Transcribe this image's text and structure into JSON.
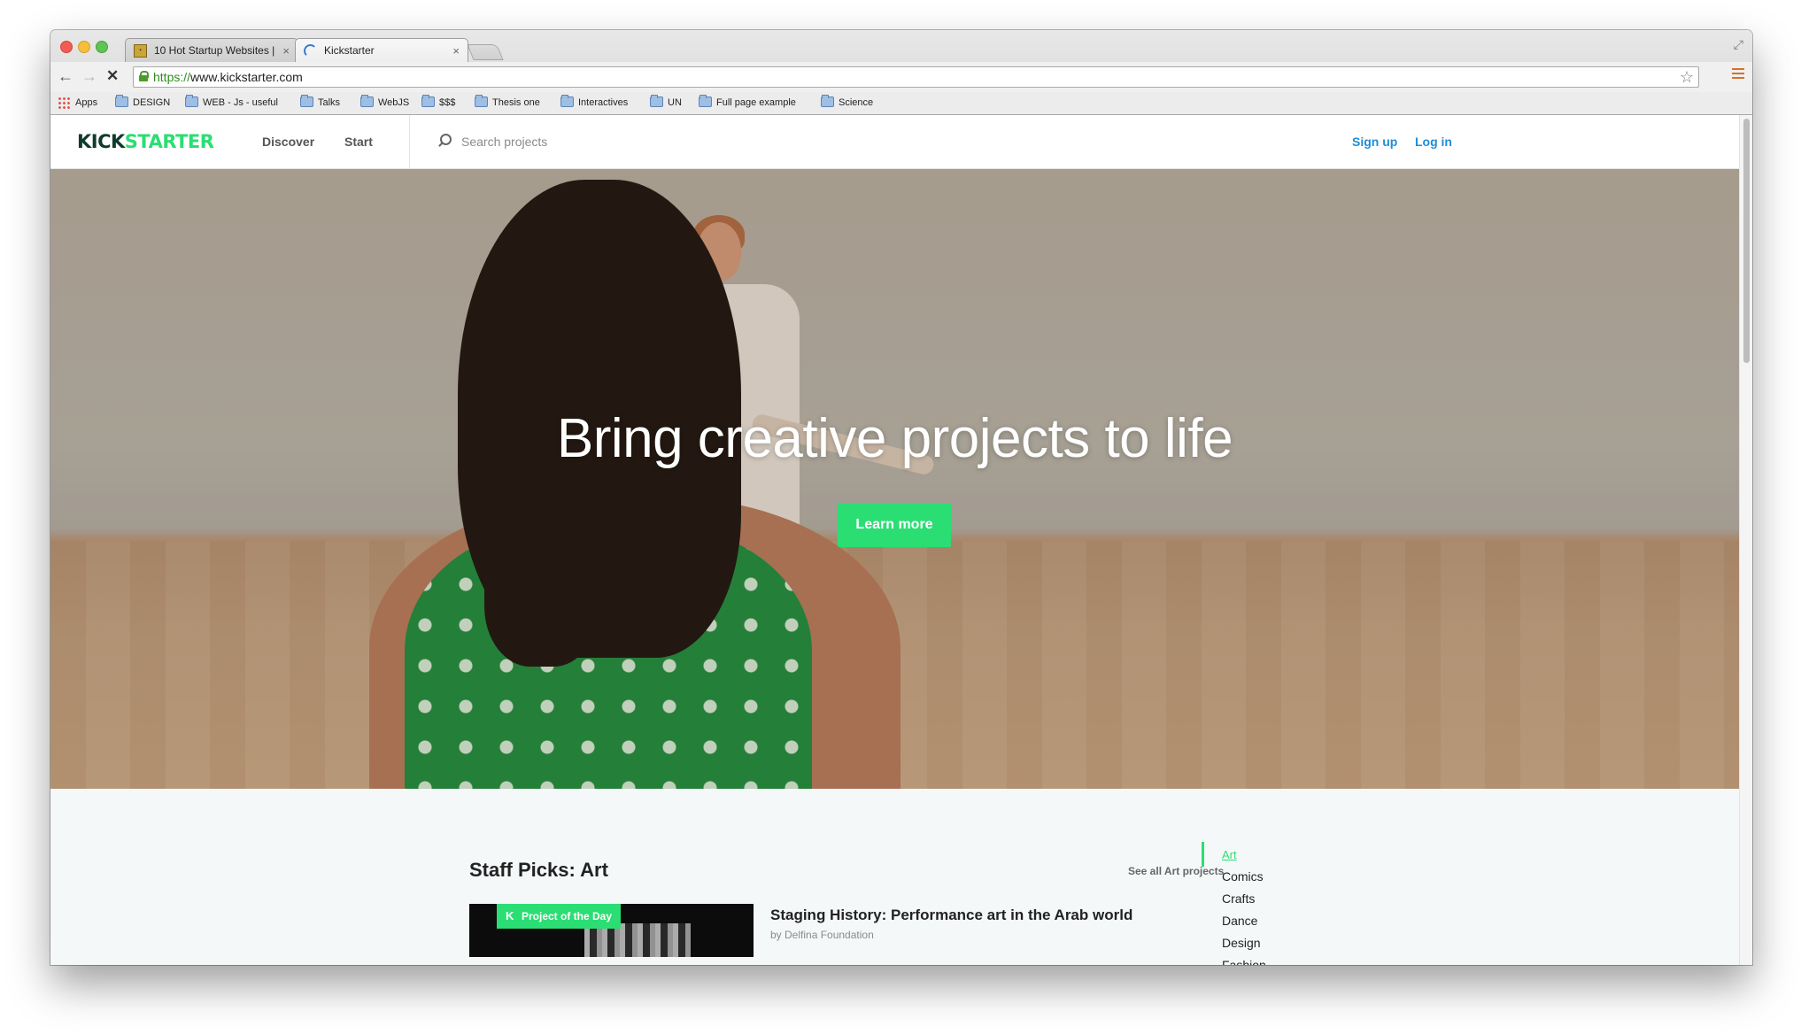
{
  "browser": {
    "tabs": [
      {
        "title": "10 Hot Startup Websites | ",
        "favicon": "newspaper-icon"
      },
      {
        "title": "Kickstarter",
        "favicon": "loading-spinner-icon"
      }
    ],
    "tab_close_glyph": "×",
    "url_scheme": "https://",
    "url_rest": "www.kickstarter.com",
    "bookmarks": [
      "Apps",
      "DESIGN",
      "WEB - Js - useful",
      "Talks",
      "WebJS",
      "$$$",
      "Thesis one",
      "Interactives",
      "UN",
      "Full page example",
      "Science"
    ]
  },
  "site": {
    "logo_part1": "KICK",
    "logo_part2": "STARTER",
    "nav": {
      "discover": "Discover",
      "start": "Start"
    },
    "search_placeholder": "Search projects",
    "signup": "Sign up",
    "login": "Log in"
  },
  "hero": {
    "title": "Bring creative projects to life",
    "cta": "Learn more"
  },
  "staff_picks": {
    "title": "Staff Picks: Art",
    "see_all": "See all Art projects",
    "badge": "Project of the Day",
    "project_title": "Staging History: Performance art in the Arab world",
    "project_by": "by Delfina Foundation",
    "categories": [
      "Art",
      "Comics",
      "Crafts",
      "Dance",
      "Design",
      "Fashion"
    ]
  },
  "colors": {
    "kickstarter_green": "#2bde73",
    "logo_dark": "#0f3b2d",
    "link_blue": "#1d8ed8"
  }
}
